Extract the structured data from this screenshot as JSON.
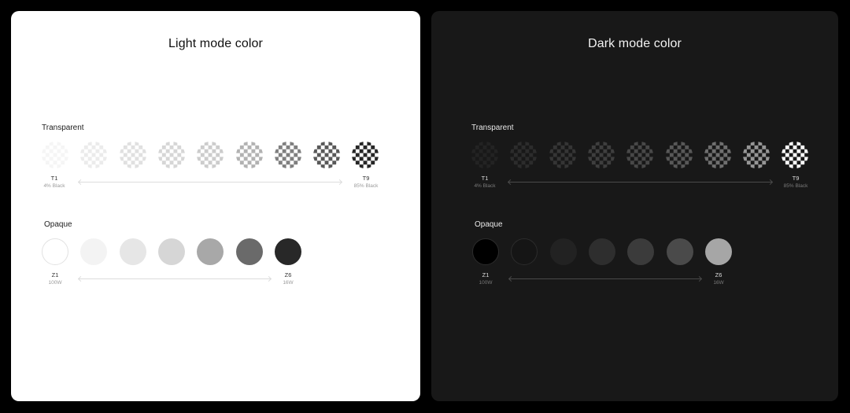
{
  "light_panel": {
    "title": "Light mode color",
    "transparent": {
      "label": "Transparent",
      "start_name": "T1",
      "start_sub": "4% Black",
      "end_name": "T9",
      "end_sub": "85% Black",
      "swatch_opacities": [
        0.04,
        0.08,
        0.12,
        0.16,
        0.2,
        0.3,
        0.5,
        0.65,
        0.85
      ],
      "check_color": "#000000"
    },
    "opaque": {
      "label": "Opaque",
      "start_name": "Z1",
      "start_sub": "100W",
      "end_name": "Z6",
      "end_sub": "16W",
      "swatch_colors": [
        "#ffffff",
        "#f3f3f3",
        "#e6e6e6",
        "#d6d6d6",
        "#a8a8a8",
        "#6a6a6a",
        "#282828"
      ]
    }
  },
  "dark_panel": {
    "title": "Dark mode color",
    "transparent": {
      "label": "Transparent",
      "start_name": "T1",
      "start_sub": "4% Black",
      "end_name": "T9",
      "end_sub": "85% Black",
      "swatch_opacities": [
        0.05,
        0.09,
        0.13,
        0.17,
        0.21,
        0.28,
        0.38,
        0.55,
        0.98
      ],
      "check_color": "#ffffff"
    },
    "opaque": {
      "label": "Opaque",
      "start_name": "Z1",
      "start_sub": "100W",
      "end_name": "Z6",
      "end_sub": "16W",
      "swatch_colors": [
        "#000000",
        "#151515",
        "#222222",
        "#2e2e2e",
        "#3b3b3b",
        "#4a4a4a",
        "#a6a6a6"
      ]
    }
  },
  "colors": {
    "page_background": "#000000",
    "light_panel_background": "#ffffff",
    "dark_panel_background": "#181818"
  }
}
